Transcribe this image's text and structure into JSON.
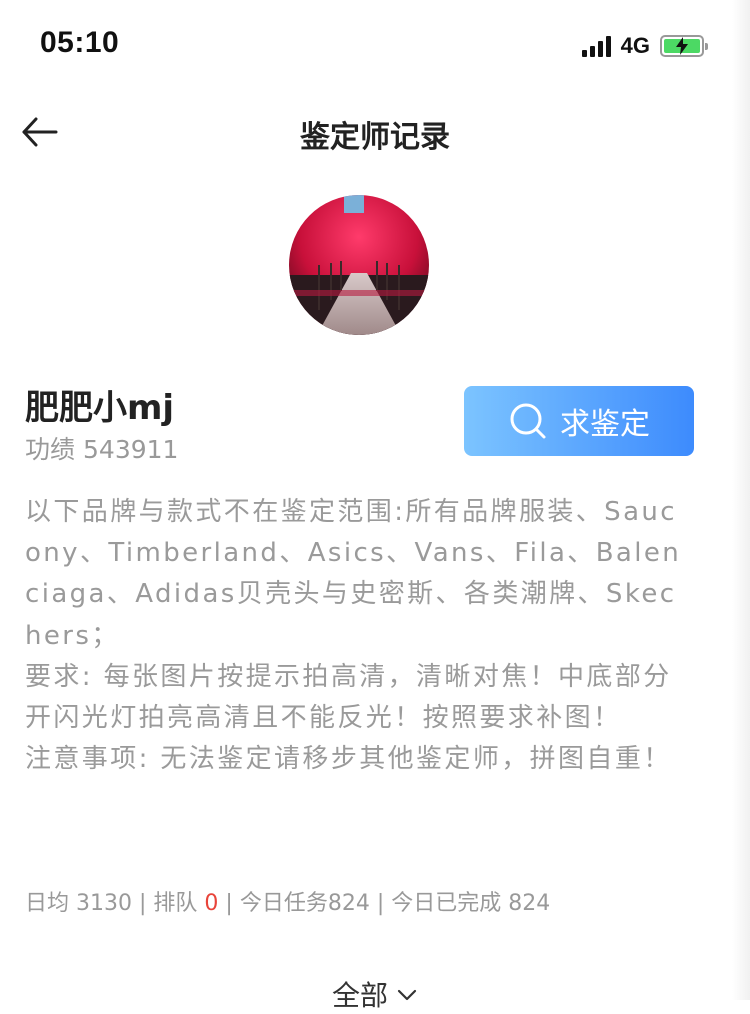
{
  "status_bar": {
    "time": "05:10",
    "network": "4G",
    "battery_charging": true,
    "battery_color": "#4cd964"
  },
  "navbar": {
    "back_icon": "arrow-left-icon",
    "title": "鉴定师记录"
  },
  "profile": {
    "name": "肥肥小mj",
    "merit_label": "功绩",
    "merit_value": "543911",
    "appraise_button": "求鉴定",
    "appraise_icon": "search-icon",
    "button_gradient": [
      "#7cc4ff",
      "#3d8bfd"
    ]
  },
  "description": [
    "以下品牌与款式不在鉴定范围:所有品牌服装、Saucony、Timberland、Asics、Vans、Fila、Balenciaga、Adidas贝壳头与史密斯、各类潮牌、Skechers；",
    "要求: 每张图片按提示拍高清，清晰对焦！中底部分开闪光灯拍亮高清且不能反光！按照要求补图！",
    "注意事项: 无法鉴定请移步其他鉴定师，拼图自重！"
  ],
  "stats": {
    "daily_avg": "日均 3130",
    "separator": "|",
    "queue_label": "排队",
    "queue_count": "0",
    "queue_color": "#e8443a",
    "today_tasks": "今日任务824",
    "today_done": "今日已完成 824"
  },
  "filter": {
    "label": "全部",
    "icon": "chevron-down-icon"
  }
}
